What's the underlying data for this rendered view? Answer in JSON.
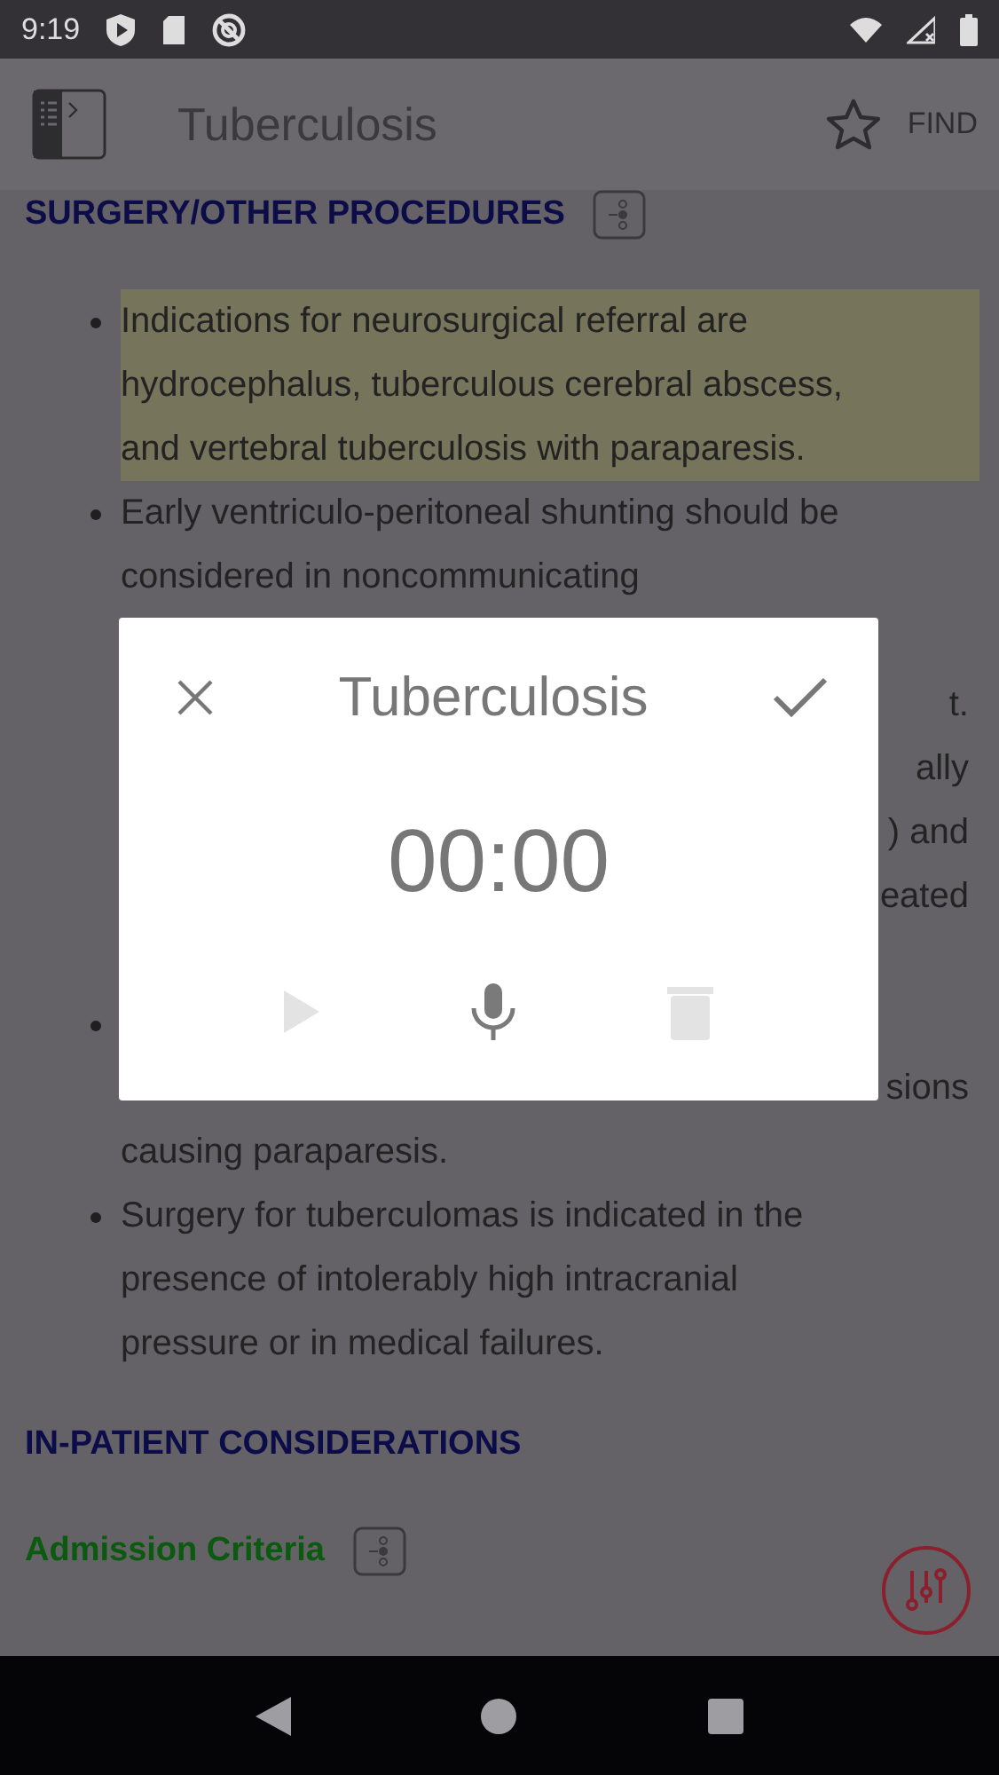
{
  "status_bar": {
    "time": "9:19"
  },
  "app_bar": {
    "title": "Tuberculosis",
    "find": "FIND"
  },
  "sections": [
    {
      "heading": "SURGERY/OTHER PROCEDURES",
      "kind": "major",
      "flow_button": true,
      "bullets": [
        {
          "highlighted": true,
          "lines": [
            {
              "kind": "line",
              "text": "Indications for neurosurgical referral are"
            },
            {
              "kind": "line",
              "text": "hydrocephalus, tuberculous cerebral abscess,"
            },
            {
              "kind": "line",
              "text": "and vertebral tuberculosis with paraparesis."
            }
          ]
        },
        {
          "lines": [
            {
              "kind": "line",
              "text": "Early ventriculo-peritoneal shunting should be"
            },
            {
              "kind": "line",
              "text": "considered in noncommunicating"
            },
            {
              "kind": "hidden"
            },
            {
              "kind": "tail",
              "text": "t."
            },
            {
              "kind": "tail",
              "text": "ally"
            },
            {
              "kind": "tail",
              "text": ") and"
            },
            {
              "kind": "tail",
              "text": "eated"
            },
            {
              "kind": "hidden"
            }
          ]
        },
        {
          "lines": [
            {
              "kind": "hidden"
            },
            {
              "kind": "tail",
              "text": "sions"
            },
            {
              "kind": "line",
              "text": "causing paraparesis."
            }
          ]
        },
        {
          "lines": [
            {
              "kind": "line",
              "text": "Surgery for tuberculomas is indicated in the"
            },
            {
              "kind": "line",
              "text": "presence of intolerably high intracranial"
            },
            {
              "kind": "line",
              "text": "pressure or in medical failures."
            }
          ]
        }
      ]
    },
    {
      "heading": "IN-PATIENT CONSIDERATIONS",
      "kind": "major"
    },
    {
      "heading": "Admission Criteria",
      "kind": "minor",
      "flow_button": true
    }
  ],
  "dialog": {
    "title": "Tuberculosis",
    "timer": "00:00",
    "controls": [
      {
        "kind": "play",
        "disabled": true
      },
      {
        "kind": "mic",
        "disabled": false
      },
      {
        "kind": "delete",
        "disabled": true
      }
    ]
  }
}
